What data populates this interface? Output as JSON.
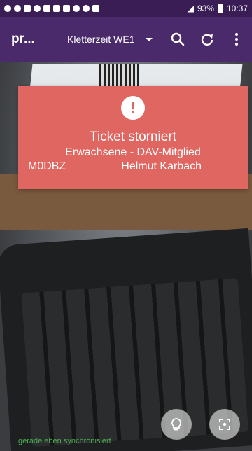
{
  "status_bar": {
    "battery": "93%",
    "time": "10:37"
  },
  "app_bar": {
    "title": "pr...",
    "event_select": "Kletterzeit WE1",
    "icons": {
      "search": "search-icon",
      "refresh": "refresh-icon",
      "menu": "more-vert-icon"
    }
  },
  "ticket": {
    "status": "Ticket storniert",
    "type": "Erwachsene - DAV-Mitglied",
    "code": "M0DBZ",
    "holder": "Helmut Karbach",
    "color": "#e06661"
  },
  "footer": {
    "sync_text": "gerade eben synchronisiert",
    "sync_color": "#4caf50"
  },
  "fabs": {
    "light": "lightbulb-icon",
    "scan": "scan-icon"
  }
}
